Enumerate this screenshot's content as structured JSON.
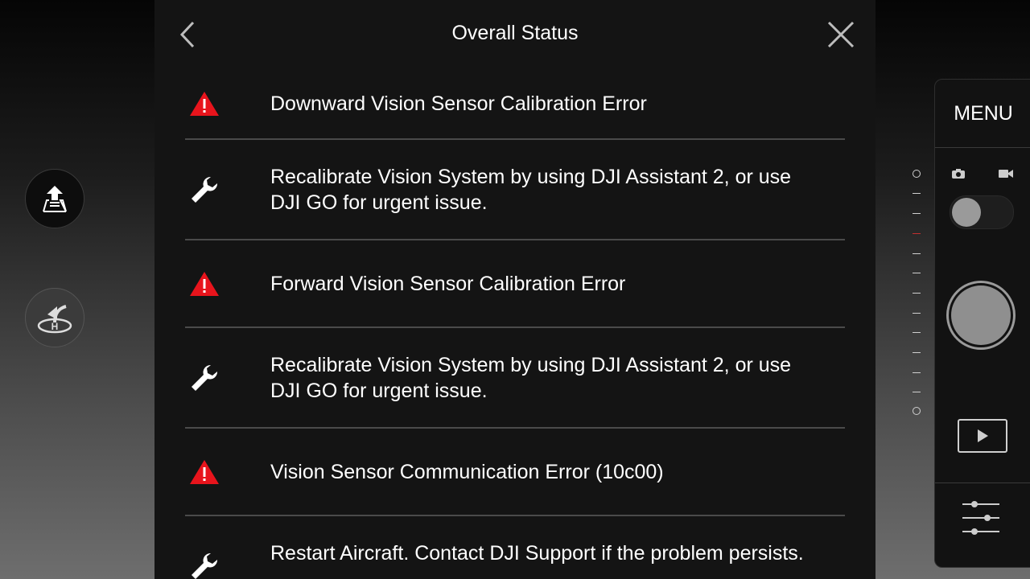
{
  "header": {
    "title": "Overall Status"
  },
  "status_items": [
    {
      "type": "error",
      "icon": "warning-icon",
      "text": "Downward Vision Sensor Calibration Error"
    },
    {
      "type": "fix",
      "icon": "wrench-icon",
      "text": "Recalibrate Vision System by using DJI Assistant 2, or use DJI GO for urgent issue."
    },
    {
      "type": "error",
      "icon": "warning-icon",
      "text": "Forward Vision Sensor Calibration Error"
    },
    {
      "type": "fix",
      "icon": "wrench-icon",
      "text": "Recalibrate Vision System by using DJI Assistant 2, or use DJI GO for urgent issue."
    },
    {
      "type": "error",
      "icon": "warning-icon",
      "text": "Vision Sensor Communication Error (10c00)"
    },
    {
      "type": "fix",
      "icon": "wrench-icon",
      "text": "Restart Aircraft. Contact DJI Support if the problem persists."
    }
  ],
  "camera_panel": {
    "menu_label": "MENU",
    "mode": "photo"
  },
  "colors": {
    "warning": "#e8141c",
    "panel_bg": "#141414",
    "divider": "#4a4a4a"
  }
}
